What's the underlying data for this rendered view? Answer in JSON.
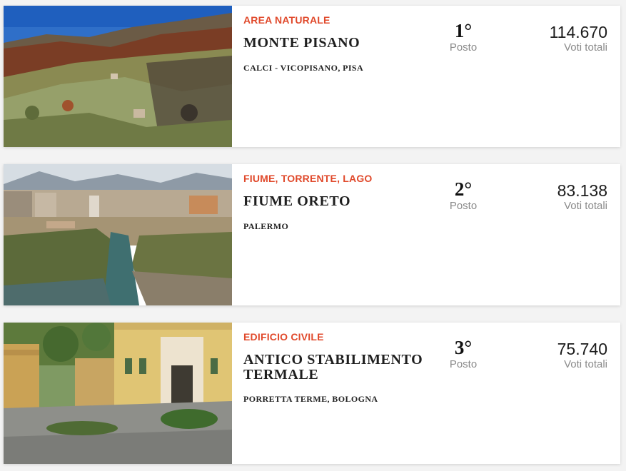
{
  "places": [
    {
      "category": "AREA NATURALE",
      "name": "MONTE PISANO",
      "location": "CALCI - VICOPISANO, PISA",
      "rank": "1°",
      "rank_label": "Posto",
      "votes": "114.670",
      "votes_label": "Voti totali"
    },
    {
      "category": "FIUME, TORRENTE, LAGO",
      "name": "FIUME ORETO",
      "location": "PALERMO",
      "rank": "2°",
      "rank_label": "Posto",
      "votes": "83.138",
      "votes_label": "Voti totali"
    },
    {
      "category": "EDIFICIO CIVILE",
      "name": "ANTICO STABILIMENTO TERMALE",
      "location": "PORRETTA TERME, BOLOGNA",
      "rank": "3°",
      "rank_label": "Posto",
      "votes": "75.740",
      "votes_label": "Voti totali"
    }
  ]
}
